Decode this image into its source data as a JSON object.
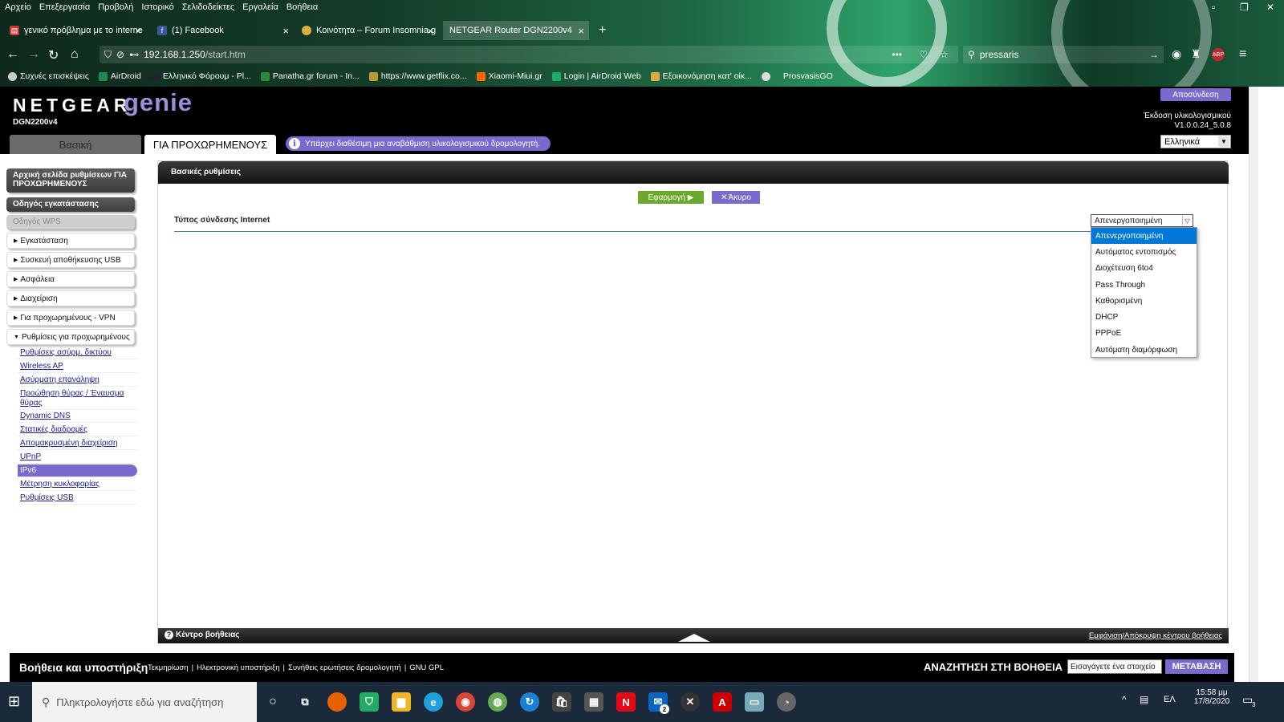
{
  "browser": {
    "menu": [
      "Αρχείο",
      "Επεξεργασία",
      "Προβολή",
      "Ιστορικό",
      "Σελιδοδείκτες",
      "Εργαλεία",
      "Βοήθεια"
    ],
    "tabs": [
      {
        "title": "γενικό πρόβλημα με το interne",
        "close": "×"
      },
      {
        "title": "(1) Facebook",
        "close": "×"
      },
      {
        "title": "Κοινότητα – Forum Insomnia.g",
        "close": "×"
      },
      {
        "title": "NETGEAR Router DGN2200v4",
        "close": "×"
      }
    ],
    "new_tab": "+",
    "url_host": "192.168.1.250",
    "url_path": "/start.htm",
    "search_value": "pressaris",
    "bookmarks": [
      "Συχνές επισκέψεις",
      "AirDroid",
      "Ελληνικό Φόρουμ - Pl...",
      "Panatha.gr forum - In...",
      "https://www.getflix.co...",
      "Xiaomi-Miui.gr",
      "Login | AirDroid Web",
      "Εξοικονόμηση κατ' οίκ...",
      "",
      "ProsvasisGO"
    ],
    "colors": {
      "accent": "#7a6acd",
      "apply": "#6aaa2a",
      "highlight": "#0078d7"
    }
  },
  "router": {
    "brand": "NETGEAR",
    "product": "genie",
    "model": "DGN2200v4",
    "logout": "Αποσύνδεση",
    "fw_label": "Έκδοση υλικολογισμικού",
    "fw_version": "V1.0.0.24_5.0.8",
    "tab_basic": "Βασική",
    "tab_adv": "ΓΙΑ ΠΡΟΧΩΡΗΜΕΝΟΥΣ",
    "update_notice": "Υπάρχει διαθέσιμη μια αναβάθμιση υλικολογισμικού δρομολογητή.",
    "language": "Ελληνικά"
  },
  "sidebar": {
    "home": "Αρχική σελίδα ρυθμίσεων ΓΙΑ ΠΡΟΧΩΡΗΜΕΝΟΥΣ",
    "wizard": "Οδηγός εγκατάστασης",
    "wps": "Οδηγός WPS",
    "groups": [
      "Εγκατάσταση",
      "Συσκευή αποθήκευσης USB",
      "Ασφάλεια",
      "Διαχείριση",
      "Για προχωρημένους - VPN",
      "Ρυθμίσεις για προχωρημένους"
    ],
    "subs": [
      "Ρυθμίσεις ασύρμ. δικτύου",
      "Wireless AP",
      "Ασύρματη επανάληψη",
      "Προώθηση θύρας / Έναυσμα θύρας",
      "Dynamic DNS",
      "Στατικές διαδρομές",
      "Απομακρυσμένη διαχείριση",
      "UPnP",
      "IPv6",
      "Μέτρηση κυκλοφορίας",
      "Ρυθμίσεις USB"
    ]
  },
  "main": {
    "title": "Βασικές ρυθμίσεις",
    "apply": "Εφαρμογή ▶",
    "cancel": "Άκυρο",
    "field_label": "Τύπος σύνδεσης Internet",
    "selected": "Απενεργοποιημένη",
    "options": [
      "Απενεργοποιημένη",
      "Αυτόματος εντοπισμός",
      "Διοχέτευση 6to4",
      "Pass Through",
      "Καθορισμένη",
      "DHCP",
      "PPPoE",
      "Αυτόματη διαμόρφωση"
    ],
    "help_center": "Κέντρο βοήθειας",
    "help_toggle": "Εμφάνιση/Απόκρυψη κέντρου βοήθειας"
  },
  "footer": {
    "title": "Βοήθεια και υποστήριξη",
    "links": [
      "Τεκμηρίωση",
      "Ηλεκτρονική υποστήριξη",
      "Συνήθεις ερωτήσεις δρομολογητή",
      "GNU GPL"
    ],
    "sep": "|",
    "search_title": "ΑΝΑΖΗΤΗΣΗ ΣΤΗ ΒΟΗΘΕΙΑ",
    "search_placeholder": "Εισαγάγετε ένα στοιχείο",
    "go": "ΜΕΤΑΒΑΣΗ"
  },
  "taskbar": {
    "search_placeholder": "Πληκτρολογήστε εδώ για αναζήτηση",
    "lang": "ΕΛ",
    "time": "15:58 μμ",
    "date": "17/8/2020",
    "mail_badge": "2",
    "notif": "3"
  }
}
